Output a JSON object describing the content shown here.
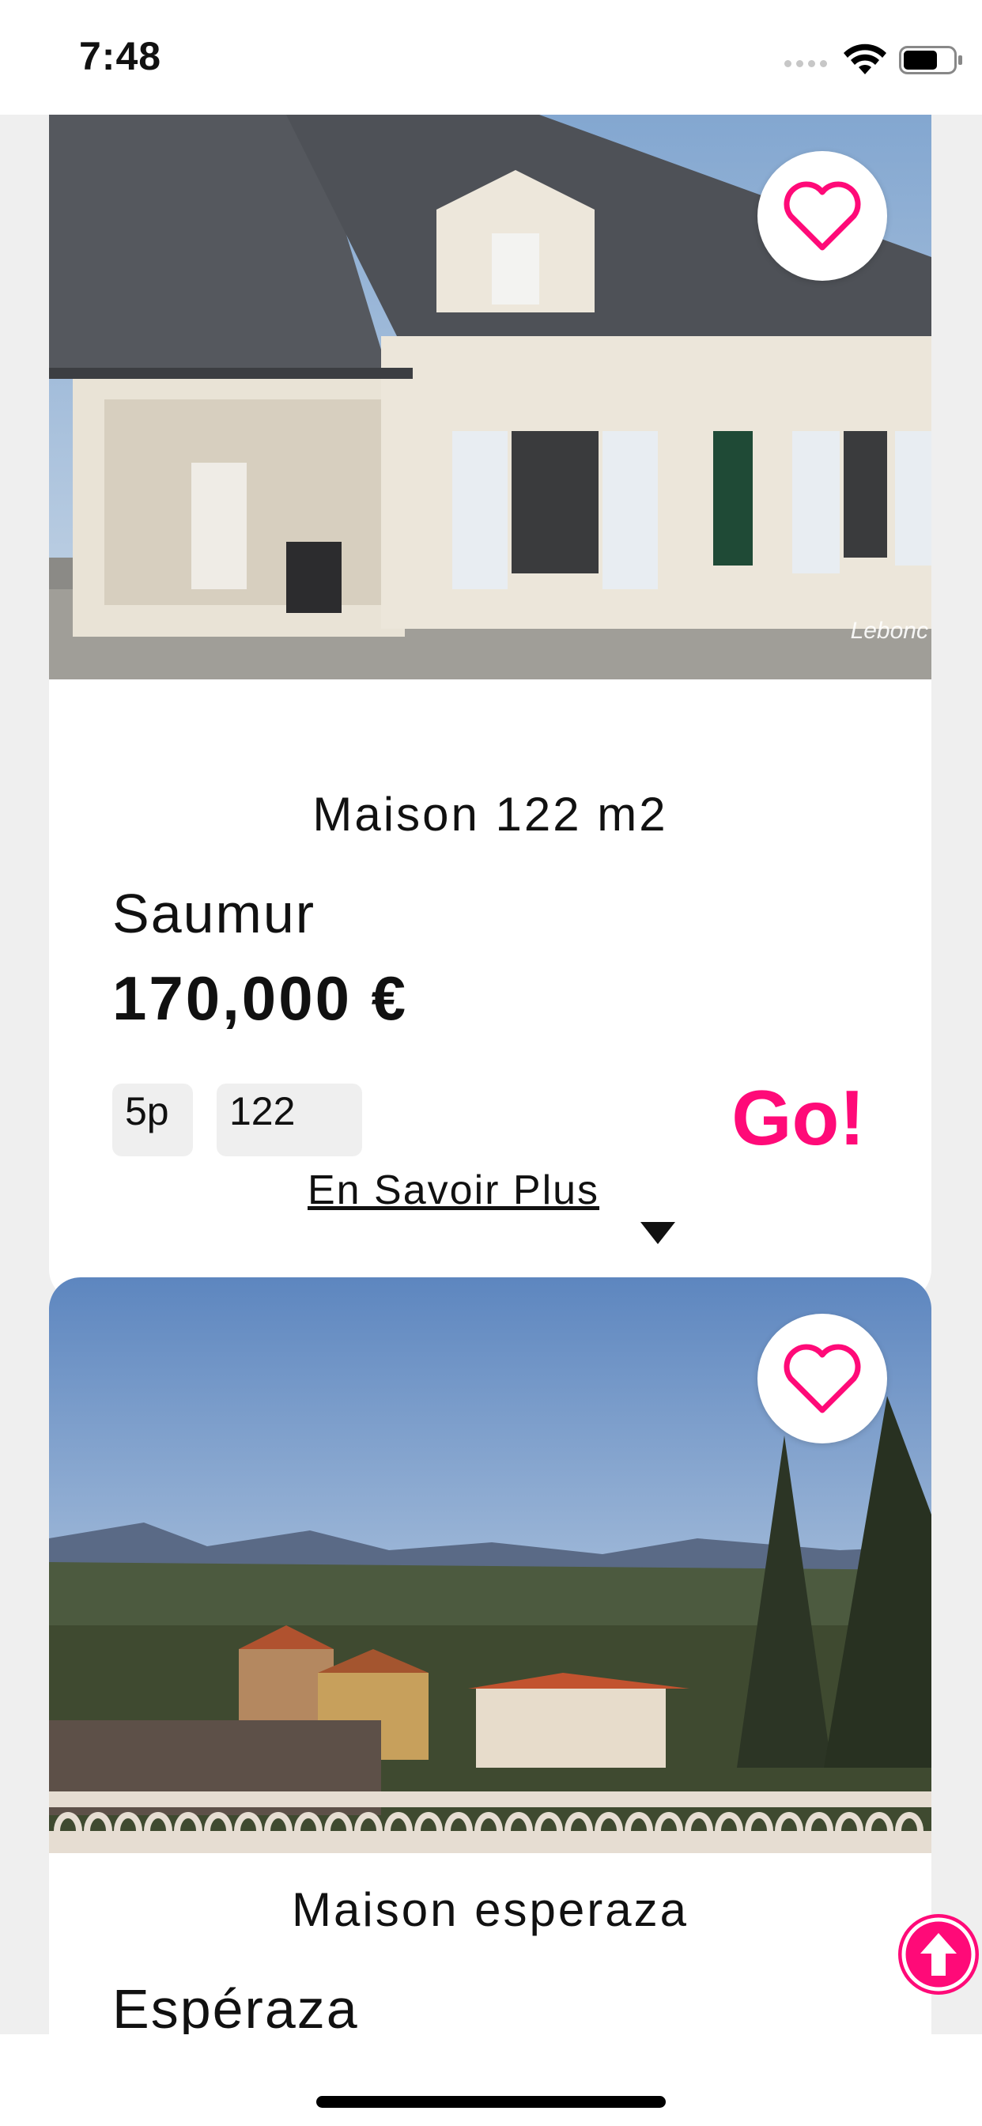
{
  "status_bar": {
    "time": "7:48",
    "icons": [
      "signal-icon",
      "wifi-icon",
      "battery-icon"
    ]
  },
  "colors": {
    "accent": "#ff0a78",
    "background": "#efefef",
    "card": "#ffffff"
  },
  "listings": [
    {
      "title": "Maison 122 m2",
      "city": "Saumur",
      "price": "170,000 €",
      "tags": [
        "5p",
        "122"
      ],
      "go_label": "Go!",
      "more_label": "En Savoir Plus",
      "photo_watermark": "Lebonc",
      "favorite_icon": "heart-outline-icon"
    },
    {
      "title": "Maison esperaza",
      "city": "Espéraza",
      "favorite_icon": "heart-outline-icon"
    }
  ],
  "floating": {
    "scroll_top_icon": "arrow-up-circle-icon"
  }
}
